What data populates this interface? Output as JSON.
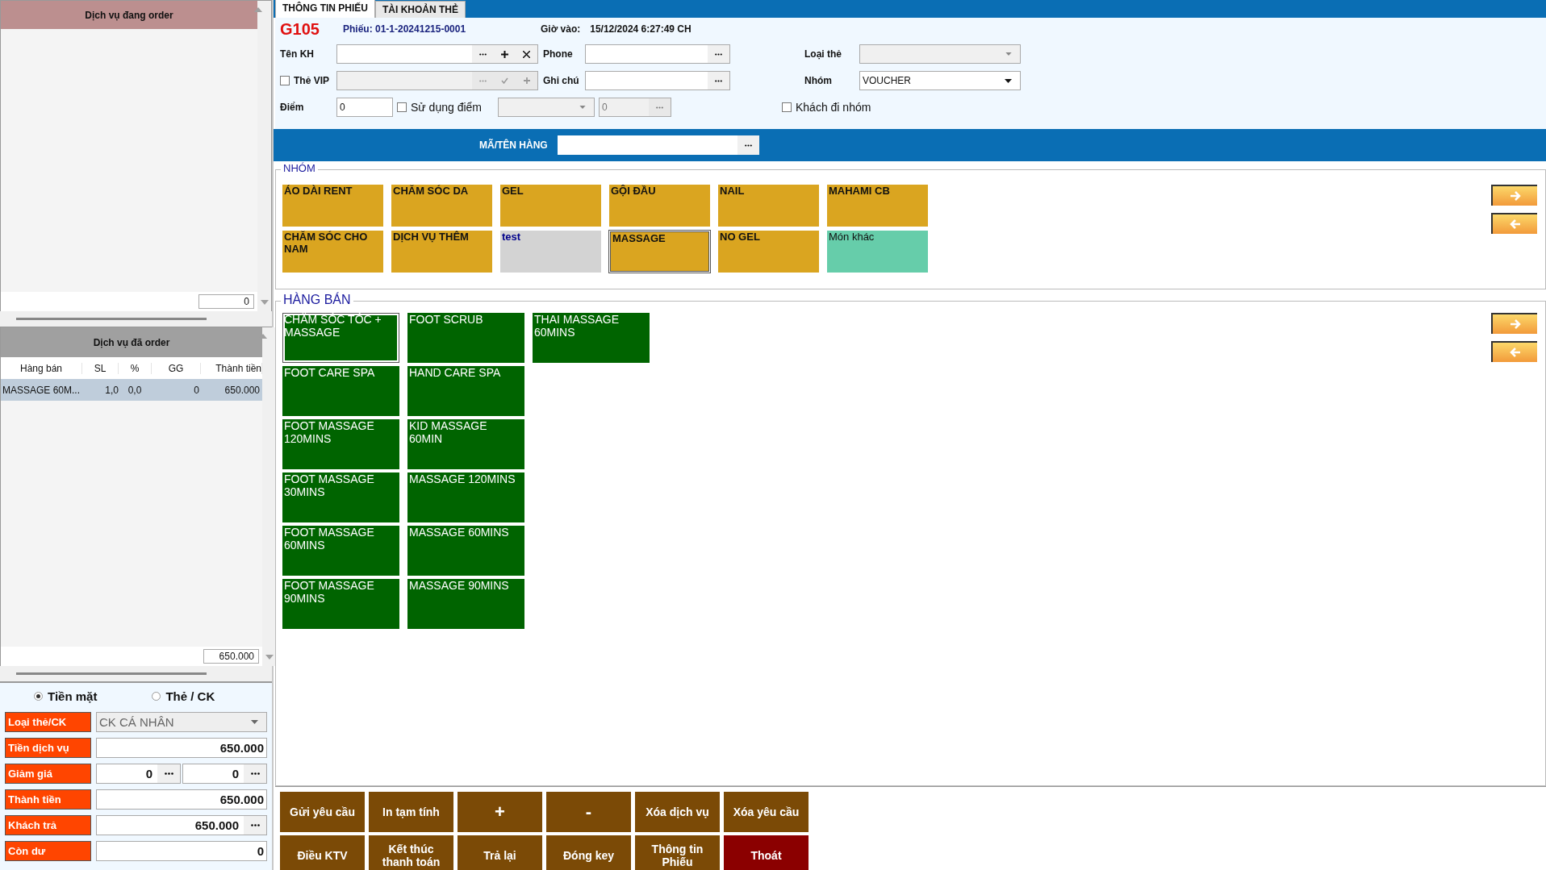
{
  "order_panel": {
    "title": "Dịch vụ đang order",
    "total": "0"
  },
  "ordered_panel": {
    "title": "Dịch vụ đã order",
    "columns": [
      "Hàng bán",
      "SL",
      "%",
      "GG",
      "Thành tiền"
    ],
    "rows": [
      {
        "cells": [
          "MASSAGE 60M...",
          "1,0",
          "0,0",
          "0",
          "650.000"
        ],
        "selected": true
      }
    ],
    "total": "650.000"
  },
  "payment": {
    "methods": [
      {
        "label": "Tiền mặt",
        "selected": true
      },
      {
        "label": "Thẻ / CK",
        "selected": false
      }
    ],
    "fields": [
      {
        "kind": "select",
        "label": "Loại thẻ/CK",
        "value": "CK CÁ NHÂN"
      },
      {
        "kind": "text",
        "label": "Tiền dịch vụ",
        "value": "650.000"
      },
      {
        "kind": "split",
        "label": "Giảm giá",
        "values": [
          "0",
          "0"
        ]
      },
      {
        "kind": "text",
        "label": "Thành tiền",
        "value": "650.000"
      },
      {
        "kind": "browse",
        "label": "Khách trả",
        "value": "650.000"
      },
      {
        "kind": "text",
        "label": "Còn dư",
        "value": "0"
      }
    ]
  },
  "tabs": [
    {
      "label": "THÔNG TIN PHIẾU",
      "selected": true
    },
    {
      "label": "TÀI KHOẢN THẺ",
      "selected": false
    }
  ],
  "ticket": {
    "table": "G105",
    "number": "Phiếu: 01-1-20241215-0001",
    "checkin_label": "Giờ vào:",
    "checkin": "15/12/2024 6:27:49 CH",
    "customer_label": "Tên KH",
    "phone_label": "Phone",
    "card_type_label": "Loại thẻ",
    "vip": {
      "label": "Thẻ VIP",
      "checked": false
    },
    "note_label": "Ghi chú",
    "group_label": "Nhóm",
    "group_value": "VOUCHER",
    "points_label": "Điểm",
    "points": "0",
    "use_points": {
      "label": "Sử dụng điểm",
      "checked": false
    },
    "points_value": "0",
    "group_visit": {
      "label": "Khách đi nhóm",
      "checked": false
    }
  },
  "search": {
    "label": "MÃ/TÊN HÀNG"
  },
  "groups": {
    "title": "NHÓM",
    "items": [
      {
        "label": "ÁO DÀI RENT",
        "color": "#daa520",
        "kind": "bold",
        "selected": false
      },
      {
        "label": "CHĂM SÓC DA",
        "color": "#daa520",
        "kind": "bold",
        "selected": false
      },
      {
        "label": "GEL",
        "color": "#daa520",
        "kind": "bold",
        "selected": false
      },
      {
        "label": "GỘI ĐẦU",
        "color": "#daa520",
        "kind": "bold",
        "selected": false
      },
      {
        "label": "NAIL",
        "color": "#daa520",
        "kind": "bold",
        "selected": false
      },
      {
        "label": "MAHAMI CB",
        "color": "#daa520",
        "kind": "bold",
        "selected": false
      },
      {
        "label": "CHĂM SÓC CHO NAM",
        "color": "#daa520",
        "kind": "bold",
        "selected": false
      },
      {
        "label": "DỊCH VỤ THÊM",
        "color": "#daa520",
        "kind": "bold",
        "selected": false
      },
      {
        "label": "test",
        "color": "#d3d3d3",
        "kind": "link",
        "selected": false
      },
      {
        "label": "MASSAGE",
        "color": "#daa520",
        "kind": "bold",
        "selected": true
      },
      {
        "label": "NO GEL",
        "color": "#daa520",
        "kind": "bold",
        "selected": false
      },
      {
        "label": "Món khác",
        "color": "#66cdaa",
        "kind": "plain",
        "selected": false
      }
    ]
  },
  "products": {
    "title": "HÀNG BÁN",
    "items": [
      {
        "label": "CHĂM SÓC TÓC + MASSAGE",
        "selected": true
      },
      {
        "label": "FOOT CARE SPA",
        "selected": false
      },
      {
        "label": "FOOT MASSAGE 120MINS",
        "selected": false
      },
      {
        "label": "FOOT MASSAGE 30MINS",
        "selected": false
      },
      {
        "label": "FOOT MASSAGE 60MINS",
        "selected": false
      },
      {
        "label": "FOOT MASSAGE 90MINS",
        "selected": false
      },
      {
        "label": "FOOT SCRUB",
        "selected": false
      },
      {
        "label": "HAND CARE SPA",
        "selected": false
      },
      {
        "label": "KID MASSAGE 60MIN",
        "selected": false
      },
      {
        "label": "MASSAGE 120MINS",
        "selected": false
      },
      {
        "label": "MASSAGE 60MINS",
        "selected": false
      },
      {
        "label": "MASSAGE 90MINS",
        "selected": false
      },
      {
        "label": "THAI MASSAGE 60MINS",
        "selected": false
      }
    ]
  },
  "actions": [
    {
      "label": "Gửi yêu cầu",
      "kind": "normal"
    },
    {
      "label": "In tạm tính",
      "kind": "normal"
    },
    {
      "label": "+",
      "kind": "big"
    },
    {
      "label": "-",
      "kind": "big"
    },
    {
      "label": "Xóa dịch vụ",
      "kind": "normal"
    },
    {
      "label": "Xóa yêu cầu",
      "kind": "normal"
    },
    {
      "label": "Điều KTV",
      "kind": "normal"
    },
    {
      "label": "Kết thúc thanh toán",
      "kind": "normal"
    },
    {
      "label": "Trả lại",
      "kind": "normal"
    },
    {
      "label": "Đóng key",
      "kind": "normal"
    },
    {
      "label": "Thông tin Phiếu",
      "kind": "normal"
    },
    {
      "label": "Thoát",
      "kind": "exit"
    }
  ]
}
